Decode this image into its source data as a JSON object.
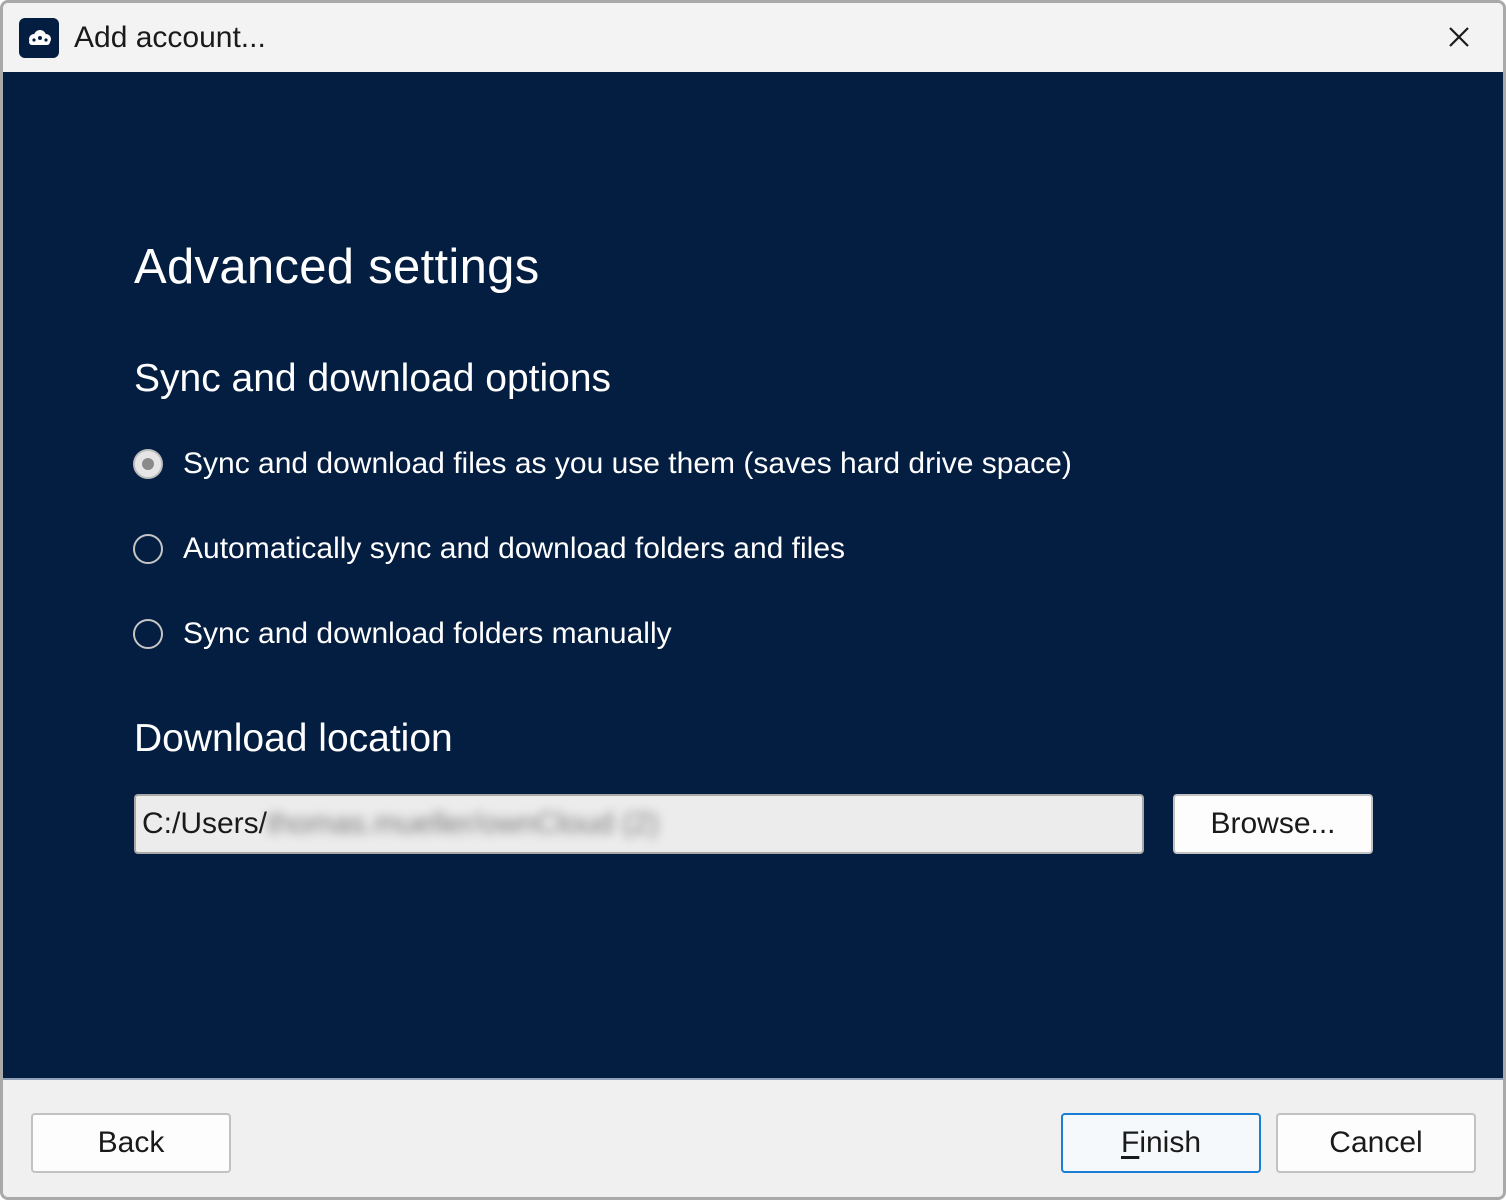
{
  "window": {
    "title": "Add account..."
  },
  "page": {
    "heading": "Advanced settings",
    "sync_section_title": "Sync and download options",
    "sync_options": [
      {
        "label": "Sync and download files as you use them (saves hard drive space)",
        "selected": true
      },
      {
        "label": "Automatically sync and download folders and files",
        "selected": false
      },
      {
        "label": "Sync and download folders manually",
        "selected": false
      }
    ],
    "download_section_title": "Download location",
    "download_path_prefix": "C:/Users/",
    "download_path_blurred": "thomas.mueller/ownCloud (2)",
    "browse_label": "Browse..."
  },
  "footer": {
    "back_label": "Back",
    "finish_mnemonic": "F",
    "finish_rest": "inish",
    "cancel_label": "Cancel"
  },
  "colors": {
    "content_bg": "#041e42",
    "footer_bg": "#f0f0f0",
    "default_button_border": "#1a7fd4"
  },
  "icons": {
    "app": "owncloud-cloud-icon",
    "close": "close-icon"
  }
}
